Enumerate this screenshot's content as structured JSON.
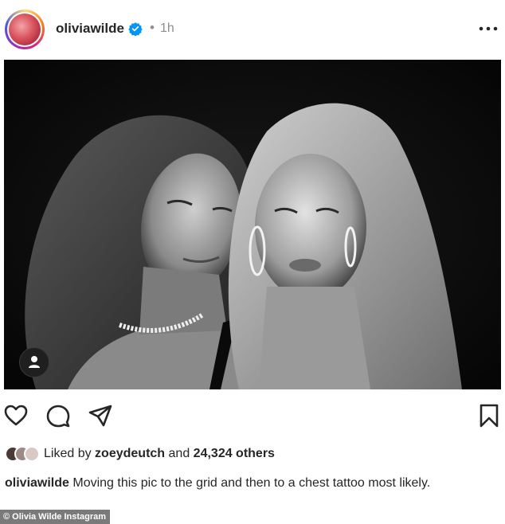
{
  "post": {
    "username": "oliviawilde",
    "separator": "•",
    "time_ago": "1h",
    "likes": {
      "prefix": "Liked by",
      "top_liker": "zoeydeutch",
      "joiner": "and",
      "count": "24,324 others"
    },
    "caption": {
      "username": "oliviawilde",
      "text": "Moving this pic to the grid and then to a chest tattoo most likely."
    }
  },
  "credit": "© Olivia Wilde Instagram",
  "icons": {
    "verified": "verified-badge-icon",
    "more": "more-options-icon",
    "tag": "user-tag-icon",
    "like": "heart-icon",
    "comment": "comment-icon",
    "share": "paper-plane-icon",
    "save": "bookmark-icon"
  },
  "colors": {
    "verified_blue": "#0095f6",
    "text": "#262626",
    "muted": "#8e8e8e"
  }
}
